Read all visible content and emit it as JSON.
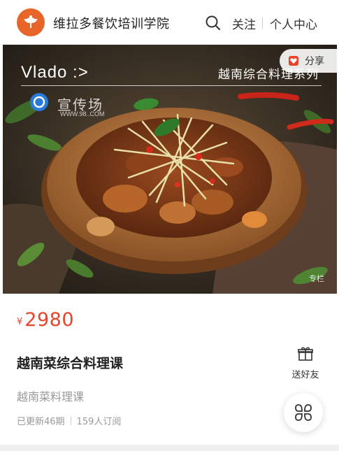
{
  "header": {
    "brand": "维拉多餐饮培训学院",
    "follow_label": "关注",
    "profile_label": "个人中心",
    "logo_icon": "phoenix-logo-icon",
    "search_icon": "search-icon"
  },
  "banner": {
    "title": "Vlado :>",
    "series": "越南综合料理系列",
    "share_label": "分享",
    "watermark_text": "宣传场",
    "watermark_url": "WWW.98..COM",
    "column_tag": "专栏",
    "image": "claypot-chicken-dish-photo"
  },
  "course": {
    "price_symbol": "¥",
    "price": "2980",
    "title": "越南菜综合料理课",
    "subtitle": "越南菜料理课",
    "updates": "已更新46期",
    "subscribers": "159人订阅",
    "gift_label": "送好友",
    "gift_icon": "gift-icon",
    "fab_icon": "grid-menu-icon"
  },
  "colors": {
    "accent": "#e8452c",
    "logo": "#e8652a"
  }
}
